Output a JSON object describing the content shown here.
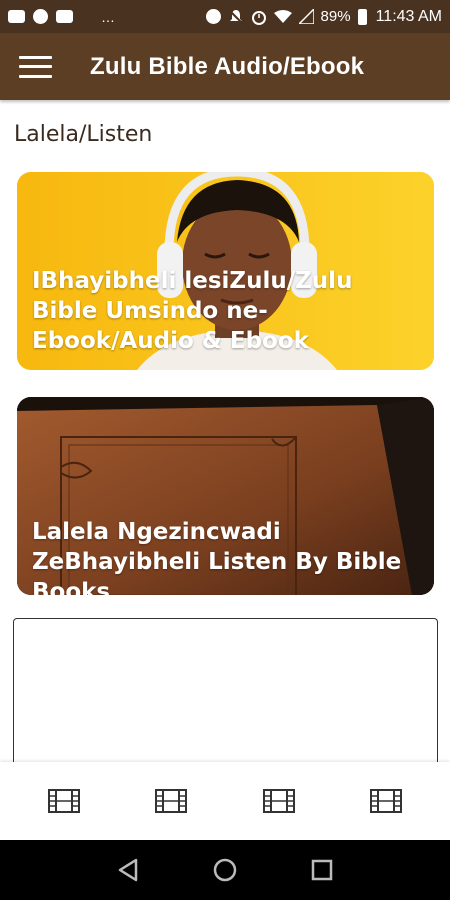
{
  "status_bar": {
    "battery": "89%",
    "time": "11:43 AM",
    "dots": "…"
  },
  "app_bar": {
    "title": "Zulu Bible Audio/Ebook",
    "menu_icon": "hamburger-icon"
  },
  "section": {
    "title": "Lalela/Listen"
  },
  "cards": [
    {
      "text": "IBhayibheli lesiZulu/Zulu Bible Umsindo ne-Ebook/Audio & Ebook",
      "background": "#f9c515"
    },
    {
      "text": "Lalela Ngezincwadi ZeBhayibheli Listen By Bible Books",
      "background": "#8b4a26"
    }
  ],
  "bottom_nav": {
    "items": [
      {
        "icon": "film-icon"
      },
      {
        "icon": "film-icon"
      },
      {
        "icon": "film-icon"
      },
      {
        "icon": "film-icon"
      }
    ]
  },
  "colors": {
    "status_bar": "#4a3220",
    "app_bar": "#5b3e24",
    "section_title": "#3b2a1e"
  }
}
